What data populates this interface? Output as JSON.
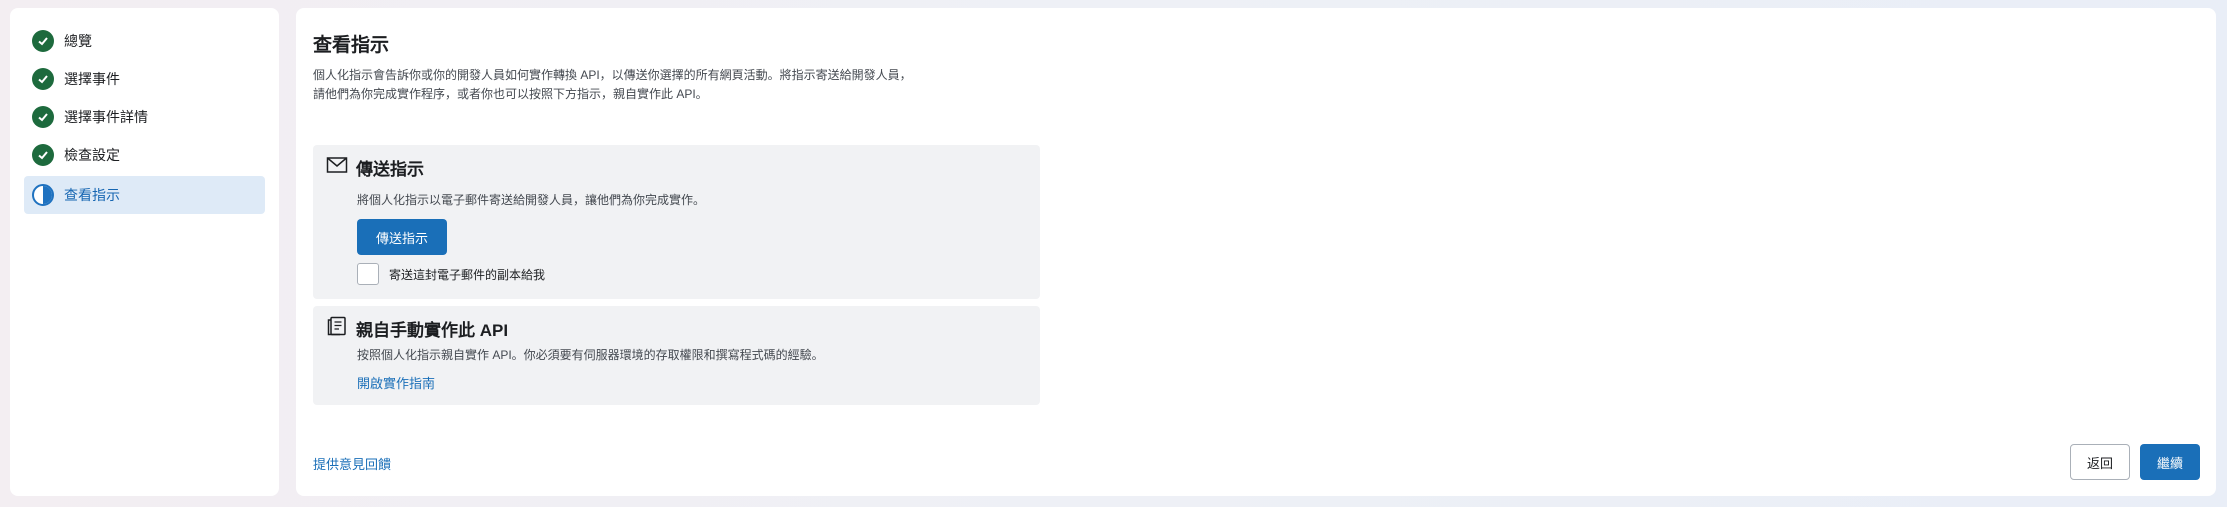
{
  "sidebar": {
    "steps": [
      {
        "label": "總覽",
        "status": "done"
      },
      {
        "label": "選擇事件",
        "status": "done"
      },
      {
        "label": "選擇事件詳情",
        "status": "done"
      },
      {
        "label": "檢查設定",
        "status": "done"
      },
      {
        "label": "查看指示",
        "status": "current"
      }
    ]
  },
  "main": {
    "title": "查看指示",
    "description": "個人化指示會告訴你或你的開發人員如何實作轉換 API，以傳送你選擇的所有網頁活動。將指示寄送給開發人員，請他們為你完成實作程序，或者你也可以按照下方指示，親自實作此 API。",
    "send_card": {
      "icon": "envelope-icon",
      "title": "傳送指示",
      "text": "將個人化指示以電子郵件寄送給開發人員，讓他們為你完成實作。",
      "button_label": "傳送指示",
      "checkbox_label": "寄送這封電子郵件的副本給我",
      "checkbox_checked": false
    },
    "manual_card": {
      "icon": "document-icon",
      "title": "親自手動實作此 API",
      "text": "按照個人化指示親自實作 API。你必須要有伺服器環境的存取權限和撰寫程式碼的經驗。",
      "link_label": "開啟實作指南"
    },
    "footer": {
      "feedback_label": "提供意見回饋",
      "back_label": "返回",
      "continue_label": "繼續"
    }
  },
  "colors": {
    "accent": "#1a6fb8",
    "done_green": "#1d6a3d",
    "active_bg": "#deeaf7"
  }
}
